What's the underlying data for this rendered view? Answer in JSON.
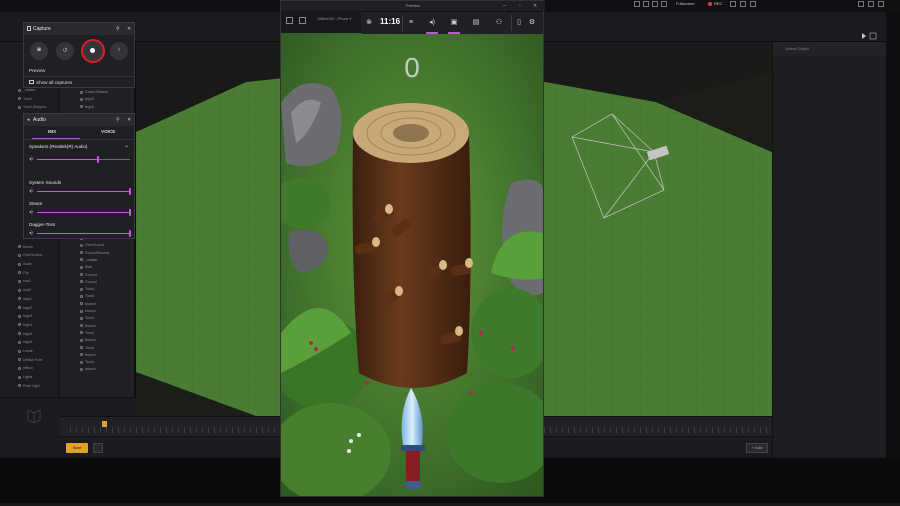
{
  "taskbar": {
    "fullscreen_label": "Fullscreen",
    "rec_label": "REC"
  },
  "game_window": {
    "title": "Preview",
    "device_label": "1080x1920 - iPhone X",
    "score": "0"
  },
  "game_bar": {
    "time": "11:16",
    "accent_color": "#b85ad6",
    "icons": [
      "xbox-icon",
      "menu-icon",
      "audio-icon",
      "capture-icon",
      "performance-icon",
      "social-icon",
      "phone-icon",
      "settings-icon"
    ]
  },
  "capture": {
    "title": "Capture",
    "preview_label": "Preview",
    "show_all_label": "Show all captures",
    "record_color": "#e31c23"
  },
  "audio": {
    "title": "Audio",
    "tabs": [
      "MIX",
      "VOICE"
    ],
    "active_tab": "MIX",
    "device": "Speakers (Realtek(R) Audio)",
    "master_volume": 0.66,
    "apps": [
      {
        "name": "System Sounds",
        "volume": 1.0
      },
      {
        "name": "Steam",
        "volume": 1.0
      },
      {
        "name": "Dagger-Toss",
        "volume": 1.0
      }
    ]
  },
  "hierarchy": {
    "left_items": [
      "_master",
      "Trunk",
      "Trunk-Stripped",
      "",
      "",
      "",
      "",
      "",
      "",
      "",
      "",
      "",
      "",
      "",
      "",
      "",
      "",
      "",
      "Knock",
      "OverGround",
      "Scale",
      "Flip",
      "root1",
      "root2",
      "regn1",
      "regn2",
      "regn3",
      "regn4",
      "regn5",
      "regn6",
      "Leads",
      "Default Font",
      "Hitbox",
      "Lights",
      "Point Light"
    ],
    "right_items": [
      "Grass Shadow",
      "regn5",
      "regn6",
      "",
      "",
      "",
      "",
      "",
      "",
      "",
      "",
      "",
      "",
      "",
      "",
      "",
      "",
      "regn1",
      "root1",
      "Start",
      "End",
      "OverGround",
      "GroundShadow",
      "_master",
      "Start",
      "Ground",
      "Ground",
      "Trunk",
      "Trunk",
      "branch",
      "branch",
      "Trunk",
      "branch",
      "Trunk",
      "branch",
      "Trunk",
      "branch",
      "Trunk",
      "branch"
    ]
  },
  "inspector": {
    "placeholder": "Select Object"
  },
  "timeline": {
    "start_label": "Start",
    "add_label": "+ Add"
  }
}
